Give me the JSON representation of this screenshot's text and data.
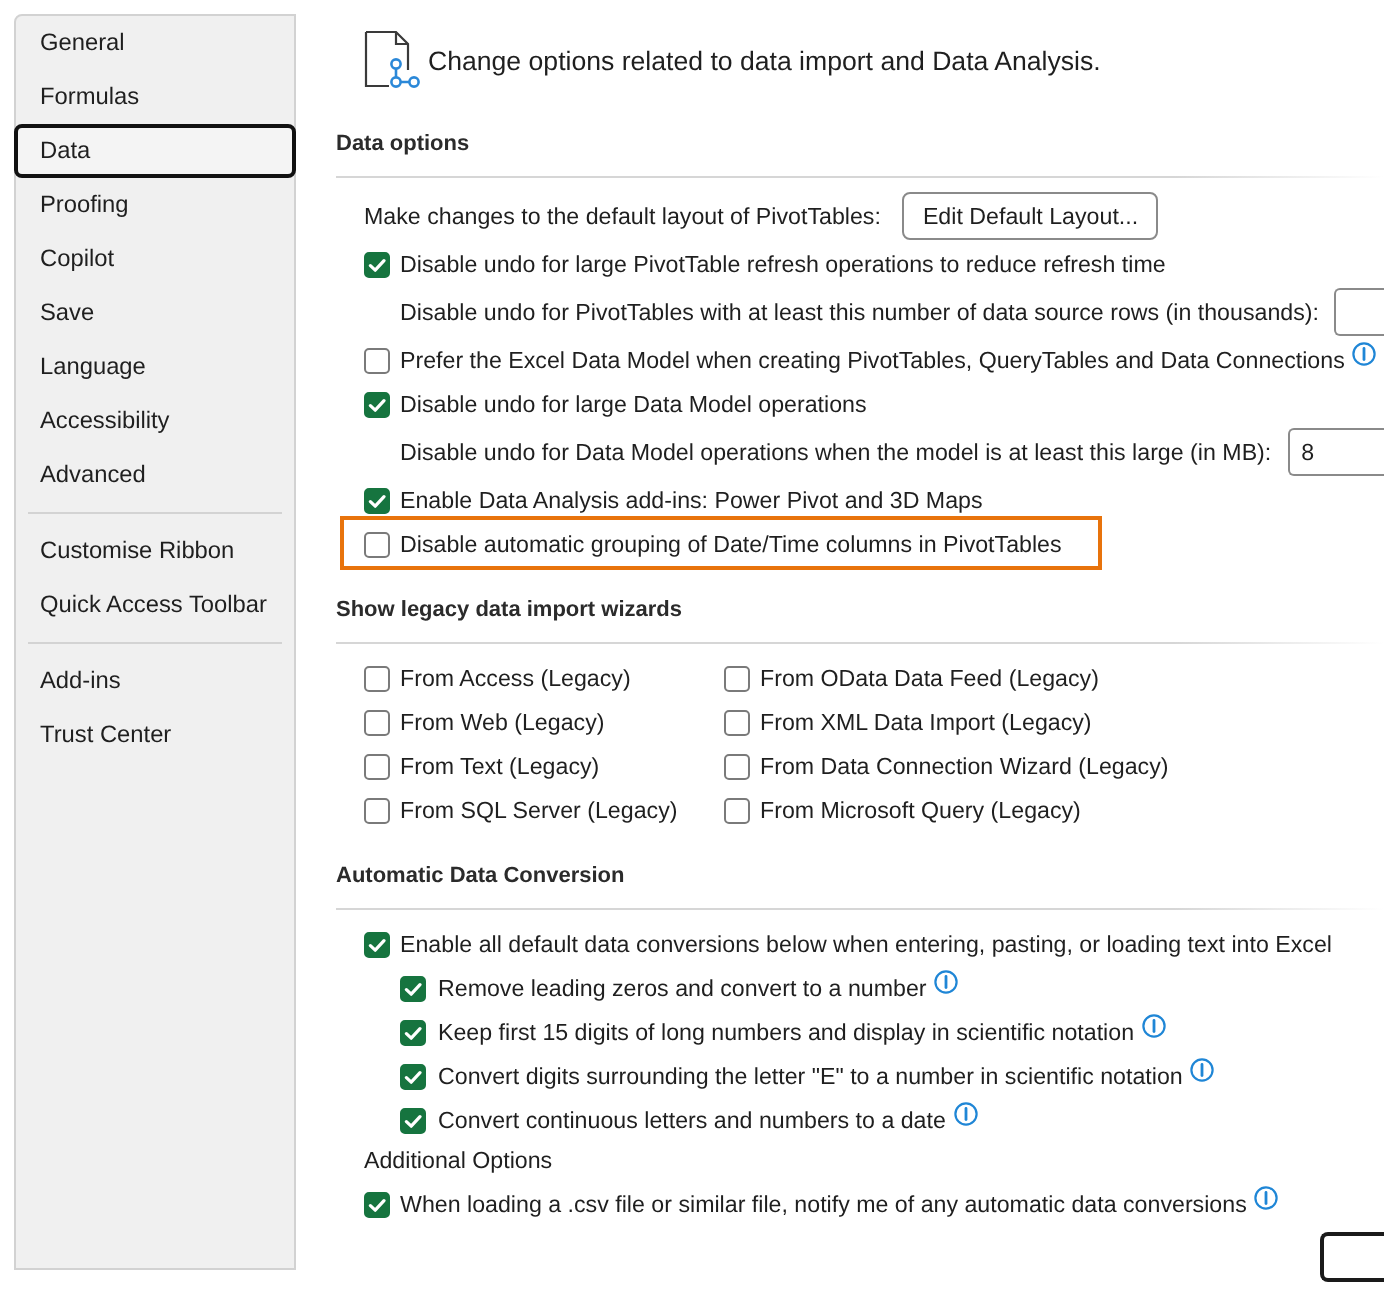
{
  "sidebar": {
    "groups": [
      [
        {
          "label": "General",
          "selected": false
        },
        {
          "label": "Formulas",
          "selected": false
        },
        {
          "label": "Data",
          "selected": true
        },
        {
          "label": "Proofing",
          "selected": false
        },
        {
          "label": "Copilot",
          "selected": false
        },
        {
          "label": "Save",
          "selected": false
        },
        {
          "label": "Language",
          "selected": false
        },
        {
          "label": "Accessibility",
          "selected": false
        },
        {
          "label": "Advanced",
          "selected": false
        }
      ],
      [
        {
          "label": "Customise Ribbon",
          "selected": false
        },
        {
          "label": "Quick Access Toolbar",
          "selected": false
        }
      ],
      [
        {
          "label": "Add-ins",
          "selected": false
        },
        {
          "label": "Trust Center",
          "selected": false
        }
      ]
    ]
  },
  "header": {
    "text": "Change options related to data import and Data Analysis."
  },
  "sections": [
    {
      "kind": "options",
      "title": "Data options",
      "items": [
        {
          "kind": "button",
          "label": "Make changes to the default layout of PivotTables:",
          "button": "Edit Default Layout..."
        },
        {
          "kind": "checkbox",
          "label": "Disable undo for large PivotTable refresh operations to reduce refresh time",
          "checked": true
        },
        {
          "kind": "number",
          "label": "Disable undo for PivotTables with at least this number of data source rows (in thousands):"
        },
        {
          "kind": "checkbox",
          "label": "Prefer the Excel Data Model when creating PivotTables, QueryTables and Data Connections",
          "checked": false,
          "info": true
        },
        {
          "kind": "checkbox",
          "label": "Disable undo for large Data Model operations",
          "checked": true
        },
        {
          "kind": "number",
          "label": "Disable undo for Data Model operations when the model is at least this large (in MB):",
          "value": "8"
        },
        {
          "kind": "checkbox",
          "label": "Enable Data Analysis add-ins: Power Pivot and 3D Maps",
          "checked": true
        },
        {
          "kind": "checkbox",
          "label": "Disable automatic grouping of Date/Time columns in PivotTables",
          "checked": false,
          "highlighted": true
        }
      ]
    },
    {
      "kind": "grid",
      "title": "Show legacy data import wizards",
      "items": [
        {
          "label": "From Access (Legacy)",
          "checked": false
        },
        {
          "label": "From OData Data Feed (Legacy)",
          "checked": false
        },
        {
          "label": "From Web (Legacy)",
          "checked": false
        },
        {
          "label": "From XML Data Import (Legacy)",
          "checked": false
        },
        {
          "label": "From Text (Legacy)",
          "checked": false
        },
        {
          "label": "From Data Connection Wizard (Legacy)",
          "checked": false
        },
        {
          "label": "From SQL Server (Legacy)",
          "checked": false
        },
        {
          "label": "From Microsoft Query (Legacy)",
          "checked": false
        }
      ]
    },
    {
      "kind": "options",
      "title": "Automatic Data Conversion",
      "items": [
        {
          "kind": "checkbox",
          "label": "Enable all default data conversions below when entering, pasting, or loading text into Excel",
          "checked": true,
          "children": [
            {
              "kind": "checkbox",
              "label": "Remove leading zeros and convert to a number",
              "checked": true,
              "info": true
            },
            {
              "kind": "checkbox",
              "label": "Keep first 15 digits of long numbers and display in scientific notation",
              "checked": true,
              "info": true
            },
            {
              "kind": "checkbox",
              "label": "Convert digits surrounding the letter \"E\" to a number in scientific notation",
              "checked": true,
              "info": true
            },
            {
              "kind": "checkbox",
              "label": "Convert continuous letters and numbers to a date",
              "checked": true,
              "info": true
            }
          ]
        },
        {
          "kind": "subheading",
          "label": "Additional Options"
        },
        {
          "kind": "checkbox",
          "label": "When loading a .csv file or similar file, notify me of any automatic data conversions",
          "checked": true,
          "info": true
        }
      ]
    }
  ],
  "footer_buttons": [
    {
      "kind": "default"
    }
  ]
}
